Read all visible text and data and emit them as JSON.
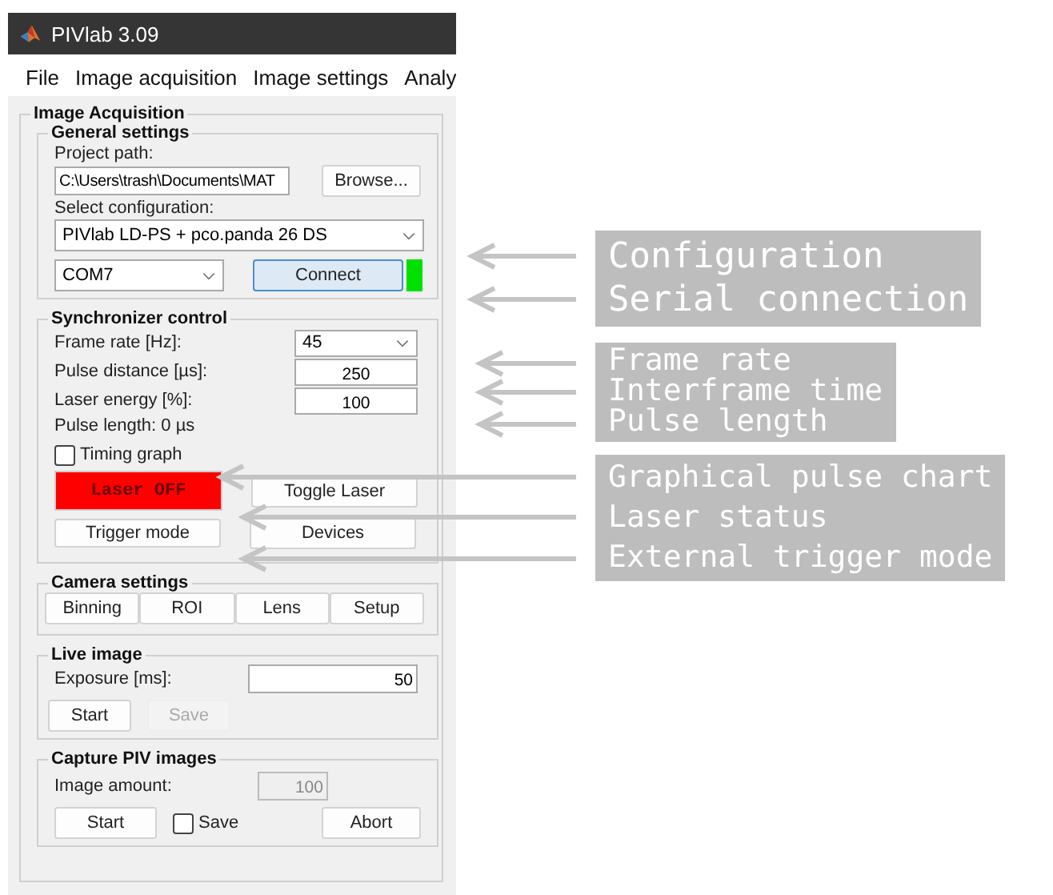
{
  "window": {
    "title": "PIVlab 3.09"
  },
  "menu": [
    "File",
    "Image acquisition",
    "Image settings",
    "Analy"
  ],
  "panel": {
    "title": "Image Acquisition",
    "general": {
      "title": "General settings",
      "project_path_label": "Project path:",
      "project_path": "C:\\Users\\trash\\Documents\\MAT",
      "browse": "Browse...",
      "config_label": "Select configuration:",
      "config": "PIVlab LD-PS + pco.panda 26 DS",
      "port": "COM7",
      "connect": "Connect",
      "connected": true
    },
    "sync": {
      "title": "Synchronizer control",
      "frame_rate_label": "Frame rate [Hz]:",
      "frame_rate": "45",
      "pulse_distance_label": "Pulse distance [µs]:",
      "pulse_distance": "250",
      "laser_energy_label": "Laser energy [%]:",
      "laser_energy": "100",
      "pulse_length": "Pulse length: 0 µs",
      "timing_graph": {
        "label": "Timing graph",
        "checked": false
      },
      "laser_status": {
        "label": "Laser OFF",
        "on": false
      },
      "toggle": "Toggle Laser",
      "trigger": "Trigger mode",
      "devices": "Devices"
    },
    "camera": {
      "title": "Camera settings",
      "buttons": [
        "Binning",
        "ROI",
        "Lens",
        "Setup"
      ]
    },
    "live": {
      "title": "Live image",
      "exposure_label": "Exposure [ms]:",
      "exposure": "50",
      "start": "Start",
      "save": {
        "label": "Save",
        "disabled": true
      }
    },
    "capture": {
      "title": "Capture PIV images",
      "amount_label": "Image amount:",
      "amount": {
        "value": "100",
        "disabled": true
      },
      "start": "Start",
      "save": {
        "label": "Save",
        "checked": false
      },
      "abort": "Abort"
    }
  },
  "annotations": [
    {
      "lines": [
        "Configuration",
        "Serial connection"
      ]
    },
    {
      "lines": [
        "Frame rate",
        "Interframe time",
        "Pulse length"
      ]
    },
    {
      "lines": [
        "Graphical pulse chart",
        "Laser status",
        "External trigger mode"
      ]
    }
  ]
}
